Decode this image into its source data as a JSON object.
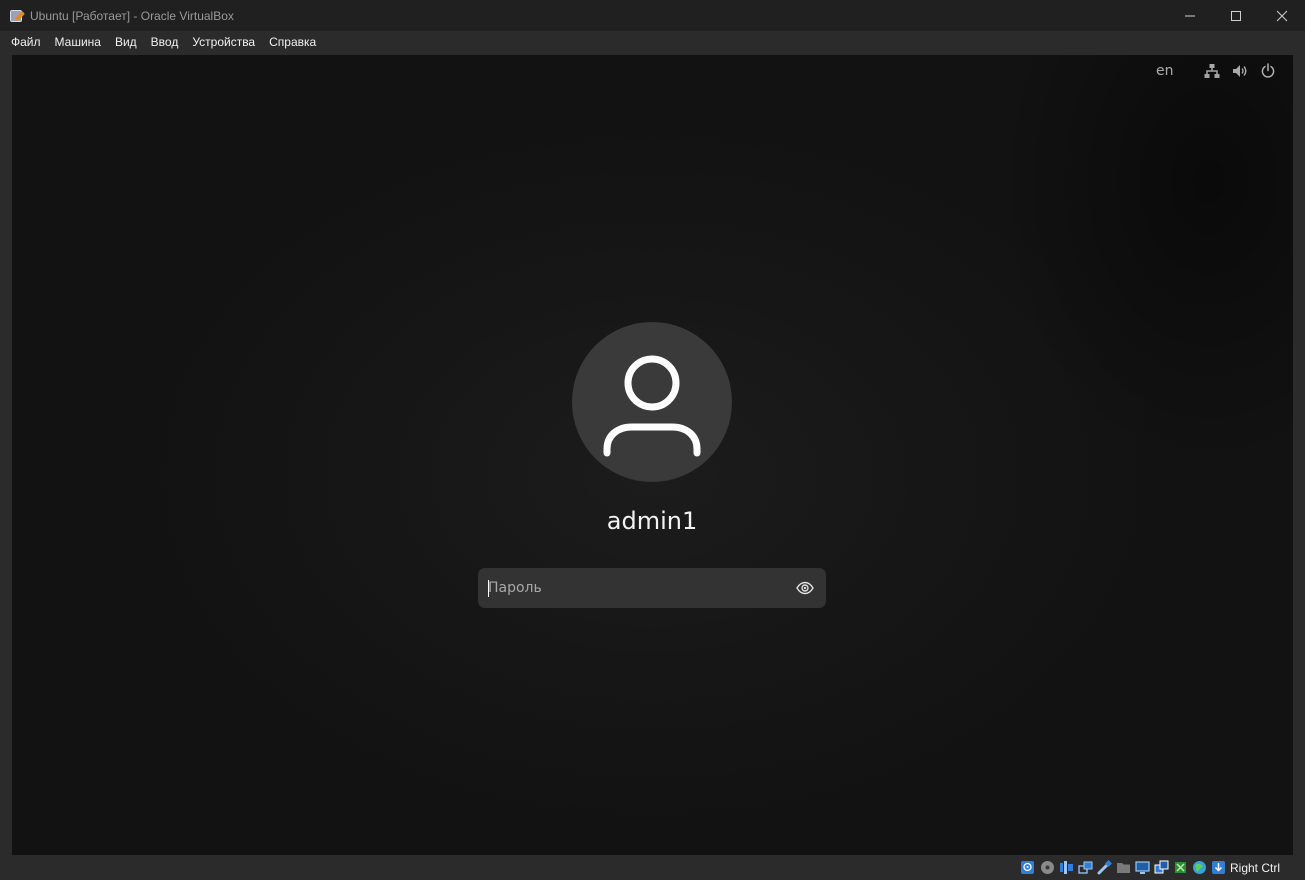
{
  "window": {
    "title": "Ubuntu [Работает] - Oracle VirtualBox",
    "icon": "virtualbox-icon",
    "controls": [
      "minimize-icon",
      "maximize-icon",
      "close-icon"
    ]
  },
  "menubar": {
    "items": [
      "Файл",
      "Машина",
      "Вид",
      "Ввод",
      "Устройства",
      "Справка"
    ]
  },
  "login": {
    "top_panel": {
      "language": "en",
      "icons": [
        "network-icon",
        "volume-icon",
        "power-icon"
      ]
    },
    "avatar_icon": "user-icon",
    "username": "admin1",
    "password": {
      "value": "",
      "placeholder": "Пароль",
      "reveal_icon": "eye-icon"
    }
  },
  "statusbar": {
    "icons": [
      "hard-disk-icon",
      "optical-disk-icon",
      "audio-icon",
      "network-icon",
      "usb-icon",
      "shared-folders-icon",
      "display-icon",
      "recording-icon",
      "cpu-icon",
      "mouse-integration-icon",
      "keyboard-icon"
    ],
    "host_key": "Right Ctrl"
  },
  "colors": {
    "titlebar": "#202020",
    "menubar": "#2b2b2b",
    "vm_background": "#161616",
    "avatar_bg": "#3a3a3a",
    "input_bg": "#333333"
  }
}
